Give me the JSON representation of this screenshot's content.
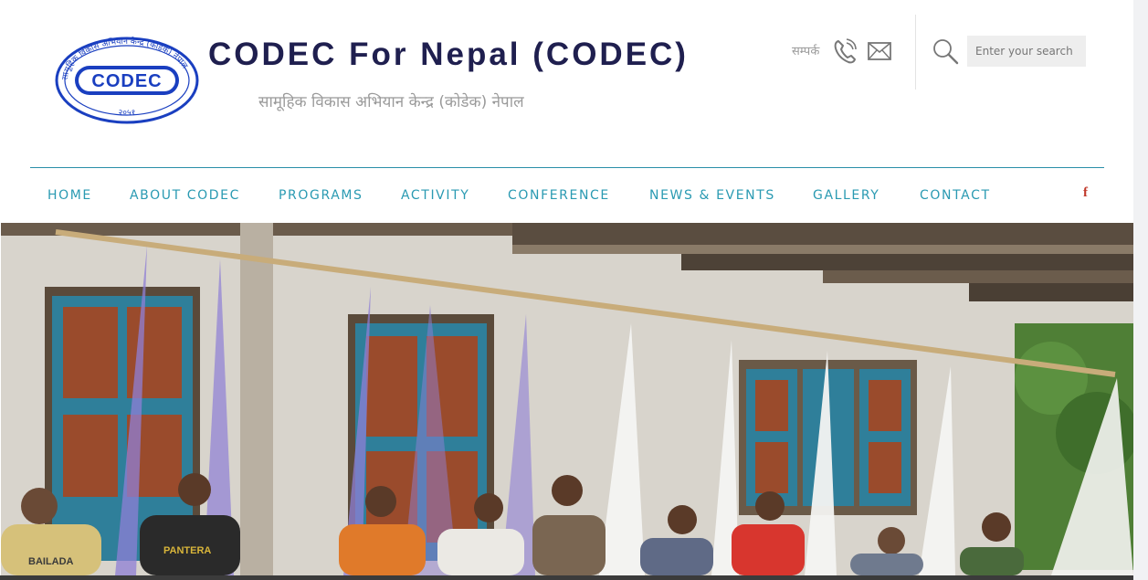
{
  "site": {
    "title": "CODEC For Nepal (CODEC)",
    "subtitle": "सामूहिक विकास अभियान केन्द्र (कोडेक) नेपाल",
    "logo_text": "CODEC",
    "logo_ring_text": "सामूहिक विकास अभियान केन्द्र (कोडेक) नेपाल",
    "logo_year": "२०५१"
  },
  "contact": {
    "label": "सम्पर्क",
    "phone_icon": "phone-icon",
    "mail_icon": "mail-icon"
  },
  "search": {
    "placeholder": "Enter your search",
    "icon": "search-icon"
  },
  "nav": {
    "items": [
      {
        "label": "HOME"
      },
      {
        "label": "ABOUT CODEC"
      },
      {
        "label": "PROGRAMS"
      },
      {
        "label": "ACTIVITY"
      },
      {
        "label": "CONFERENCE"
      },
      {
        "label": "NEWS & EVENTS"
      },
      {
        "label": "GALLERY"
      },
      {
        "label": "CONTACT"
      }
    ],
    "social": {
      "facebook": "f"
    }
  },
  "hero": {
    "shirt_text": "BAILADA",
    "shirt_text_2": "PANTERA"
  },
  "colors": {
    "accent": "#2a9ab2",
    "title": "#1f1f4f",
    "logo_blue": "#1a3fc0",
    "facebook": "#c0392b"
  }
}
